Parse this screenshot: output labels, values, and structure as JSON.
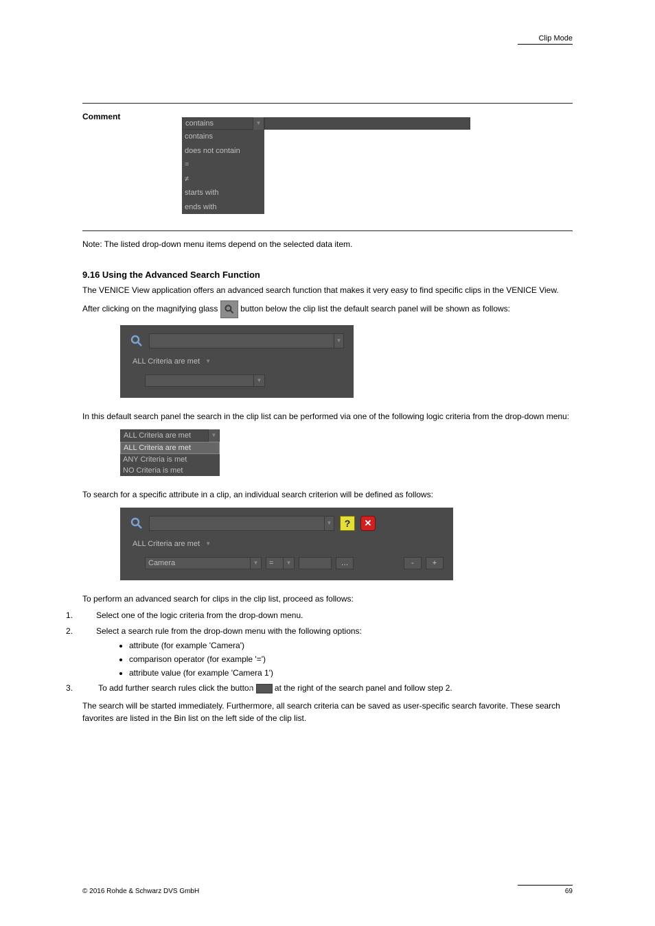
{
  "header": {
    "category": "Clip Mode"
  },
  "row_comment": {
    "label": "Comment",
    "dropdown_selected": "contains",
    "dropdown_items": [
      "contains",
      "does not contain",
      "=",
      "≠",
      "starts with",
      "ends with"
    ],
    "input_placeholder": ""
  },
  "note": "Note: The listed drop-down menu items depend on the selected data item.",
  "s916": {
    "heading": "9.16 Using the Advanced Search Function",
    "p1": "The VENICE View application offers an advanced search function that makes it very easy to find specific clips in the VENICE View.",
    "p2_pre": "After clicking on the magnifying glass ",
    "p2_post": " button below the clip list the default search panel will be shown as follows:",
    "fig_panel1_criteria": "ALL Criteria are met",
    "p3": "In this default search panel the search in the clip list can be performed via one of the following logic criteria from the drop-down menu:",
    "criteria_menu_selected": "ALL Criteria are met",
    "criteria_menu_items": [
      "ALL Criteria are met",
      "ANY Criteria is met",
      "NO Criteria is met"
    ],
    "p4": "To search for a specific attribute in a clip, an individual search criterion will be defined as follows:",
    "fig_panel2": {
      "criteria": "ALL Criteria are met",
      "attr": "Camera",
      "op": "="
    },
    "proc_intro": "To perform an advanced search for clips in the clip list, proceed as follows:",
    "step1": "Select one of the logic criteria from the drop-down menu.",
    "step2": "Select a search rule from the drop-down menu with the following options:",
    "step2_opts": [
      "attribute (for example 'Camera')",
      "comparison operator (for example '=')",
      "attribute value (for example 'Camera 1')"
    ],
    "step3_pre": "To add further search rules click the button ",
    "step3_post": " at the right of the search panel and follow step 2.",
    "p5": "The search will be started immediately. Furthermore, all search criteria can be saved as user-specific search favorite. These search favorites are listed in the Bin list on the left side of the clip list."
  },
  "footer": {
    "left": "© 2016 Rohde & Schwarz DVS GmbH",
    "right": "69"
  }
}
